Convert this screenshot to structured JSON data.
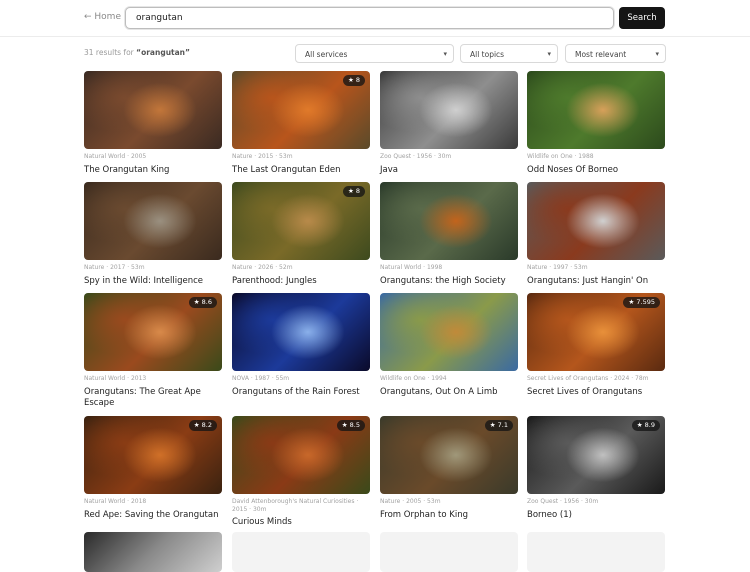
{
  "header": {
    "home_label": "← Home",
    "search_value": "orangutan",
    "search_button": "Search"
  },
  "results": {
    "count_prefix": "31 results for ",
    "query": "“orangutan”"
  },
  "filters": {
    "services": "All services",
    "topics": "All topics",
    "sort": "Most relevant"
  },
  "cards": [
    {
      "meta": "Natural World · 2005",
      "title": "The Orangutan King",
      "rating": "",
      "colors": [
        "#3a2a22",
        "#7a4a2e",
        "#c2763a"
      ]
    },
    {
      "meta": "Nature · 2015 · 53m",
      "title": "The Last Orangutan Eden",
      "rating": "★ 8",
      "colors": [
        "#5a4a2a",
        "#b8551c",
        "#e07a2a"
      ]
    },
    {
      "meta": "Zoo Quest · 1956 · 30m",
      "title": "Java",
      "rating": "",
      "colors": [
        "#3a3a3a",
        "#8e8e8e",
        "#cfcfcf"
      ]
    },
    {
      "meta": "Wildlife on One · 1988",
      "title": "Odd Noses Of Borneo",
      "rating": "",
      "colors": [
        "#2c4a1c",
        "#4e7a2c",
        "#d7a05a"
      ]
    },
    {
      "meta": "Nature · 2017 · 53m",
      "title": "Spy in the Wild: Intelligence",
      "rating": "",
      "colors": [
        "#3a2a1e",
        "#6a4a30",
        "#9a9080"
      ]
    },
    {
      "meta": "Nature · 2026 · 52m",
      "title": "Parenthood: Jungles",
      "rating": "★ 8",
      "colors": [
        "#3d4a1e",
        "#7a6a28",
        "#b88a4a"
      ]
    },
    {
      "meta": "Natural World · 1998",
      "title": "Orangutans: the High Society",
      "rating": "",
      "colors": [
        "#2a3a2a",
        "#5a6a4a",
        "#c2641c"
      ]
    },
    {
      "meta": "Nature · 1997 · 53m",
      "title": "Orangutans: Just Hangin' On",
      "rating": "",
      "colors": [
        "#5a5a5a",
        "#8a3a1e",
        "#d0d0d0"
      ]
    },
    {
      "meta": "Natural World · 2013",
      "title": "Orangutans: The Great Ape Escape",
      "rating": "★ 8.6",
      "colors": [
        "#3a4a1a",
        "#9a4a1e",
        "#d88a4a"
      ]
    },
    {
      "meta": "NOVA · 1987 · 55m",
      "title": "Orangutans of the Rain Forest",
      "rating": "",
      "colors": [
        "#0a0a2a",
        "#1c3a9a",
        "#8ab0ea"
      ]
    },
    {
      "meta": "Wildlife on One · 1994",
      "title": "Orangutans, Out On A Limb",
      "rating": "",
      "colors": [
        "#3a6aa2",
        "#8a9a4a",
        "#c08a3a"
      ]
    },
    {
      "meta": "Secret Lives of Orangutans · 2024 · 78m",
      "title": "Secret Lives of Orangutans",
      "rating": "★ 7.595",
      "colors": [
        "#5a2a10",
        "#b4561c",
        "#e8903a"
      ]
    },
    {
      "meta": "Natural World · 2018",
      "title": "Red Ape: Saving the Orangutan",
      "rating": "★ 8.2",
      "colors": [
        "#3a2210",
        "#8a3c14",
        "#d07028"
      ]
    },
    {
      "meta": "David Attenborough's Natural Curiosities · 2015 · 30m",
      "title": "Curious Minds",
      "rating": "★ 8.5",
      "colors": [
        "#3a4a1a",
        "#8a3a16",
        "#c8682a"
      ]
    },
    {
      "meta": "Nature · 2005 · 53m",
      "title": "From Orphan to King",
      "rating": "★ 7.1",
      "colors": [
        "#3a3a2a",
        "#6a4a2a",
        "#a0987a"
      ]
    },
    {
      "meta": "Zoo Quest · 1956 · 30m",
      "title": "Borneo (1)",
      "rating": "★ 8.9",
      "colors": [
        "#1a1a1a",
        "#5a5a5a",
        "#c0c0c0"
      ]
    }
  ]
}
